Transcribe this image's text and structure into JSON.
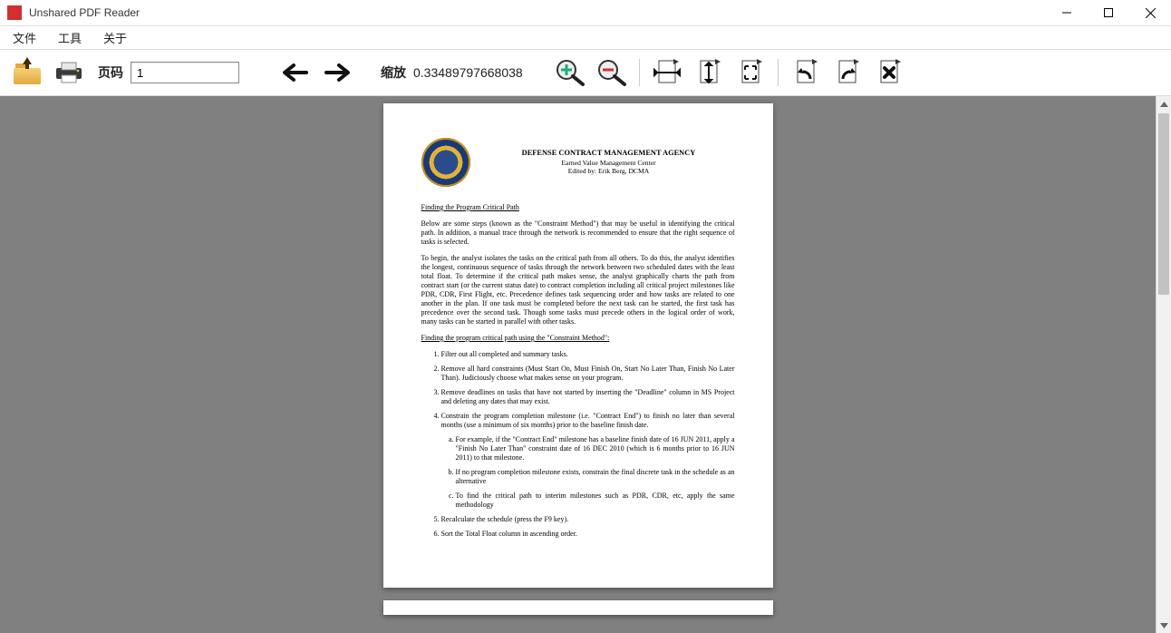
{
  "window": {
    "title": "Unshared PDF Reader"
  },
  "menubar": {
    "file": "文件",
    "tools": "工具",
    "about": "关于"
  },
  "toolbar": {
    "page_label": "页码",
    "page_value": "1",
    "zoom_label": "缩放",
    "zoom_value": "0.33489797668038"
  },
  "document": {
    "header": {
      "title": "DEFENSE CONTRACT MANAGEMENT AGENCY",
      "subtitle": "Earned Value Management Center",
      "edited_by": "Edited by: Erik Berg, DCMA"
    },
    "section_title_1": "Finding the Program Critical Path",
    "para1": "Below are some steps (known as the \"Constraint Method\") that may be useful in identifying the critical path. In addition, a manual trace through the network is recommended to ensure that the right sequence of tasks is selected.",
    "para2": "To begin, the analyst isolates the tasks on the critical path from all others. To do this, the analyst identifies the longest, continuous sequence of tasks through the network between two scheduled dates with the least total float. To determine if the critical path makes sense, the analyst graphically charts the path from contract start (or the current status date) to contract completion including all critical project milestones like PDR, CDR, First Flight, etc. Precedence defines task sequencing order and how tasks are related to one another in the plan. If one task must be completed before the next task can be started, the first task has precedence over the second task. Though some tasks must precede others in the logical order of work, many tasks can be started in parallel with other tasks.",
    "section_title_2": "Finding the program critical path using the \"Constraint Method\":",
    "steps": {
      "s1": "Filter out all completed and summary tasks.",
      "s2": "Remove all hard constraints (Must Start On, Must Finish On, Start No Later Than, Finish No Later Than). Judiciously choose what makes sense on your program.",
      "s3": "Remove deadlines on tasks that have not started by inserting the \"Deadline\" column in MS Project and deleting any dates that may exist.",
      "s4": "Constrain the program completion milestone (i.e. \"Contract End\") to finish no later than several months (use a minimum of six months) prior to the baseline finish date.",
      "s4a": "For example, if the \"Contract End\" milestone has a baseline finish date of 16 JUN 2011, apply a \"Finish No Later Than\" constraint date of 16 DEC 2010 (which is 6 months prior to 16 JUN 2011) to that milestone.",
      "s4b": "If no program completion milestone exists, constrain the final discrete task in the schedule as an alternative",
      "s4c": "To find the critical path to interim milestones such as PDR, CDR, etc, apply the same methodology",
      "s5": "Recalculate the schedule (press the F9 key).",
      "s6": "Sort the Total Float column in ascending order."
    }
  }
}
